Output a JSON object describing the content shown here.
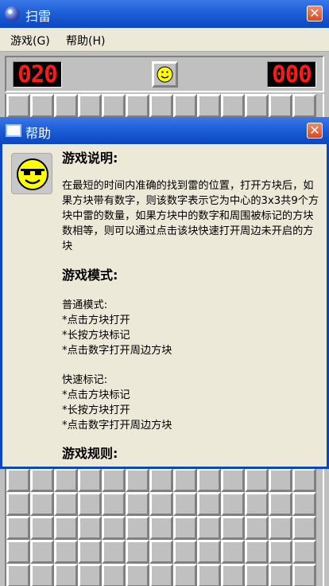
{
  "window": {
    "title": "扫雷",
    "close_label": "✕"
  },
  "menu": {
    "items": [
      "游戏(G)",
      "帮助(H)"
    ]
  },
  "status": {
    "mine_count": "020",
    "timer": "000",
    "smiley": "smiley-face-icon"
  },
  "help": {
    "title": "帮助",
    "close_label": "✕",
    "face_icon": "sunglasses-face-icon",
    "sections": {
      "description": {
        "heading": "游戏说明:",
        "body": "在最短的时间内准确的找到雷的位置，打开方块后，如果方块带有数字，则该数字表示它为中心的3x3共9个方块中雷的数量，如果方块中的数字和周围被标记的方块数相等，则可以通过点击该块快速打开周边未开启的方块"
      },
      "modes": {
        "heading": "游戏模式:",
        "normal": "普通模式:\n*点击方块打开\n*长按方块标记\n*点击数字打开周边方块",
        "fast": "快速标记:\n*点击方块标记\n*长按方块打开\n*点击数字打开周边方块"
      },
      "rules": {
        "heading": "游戏规则:"
      }
    }
  },
  "colors": {
    "titlebar": "#1e5fd8",
    "counter_digits": "#ff1a1a",
    "dialog_bg": "#ece9d8",
    "board_cell": "#c0c0c0"
  }
}
